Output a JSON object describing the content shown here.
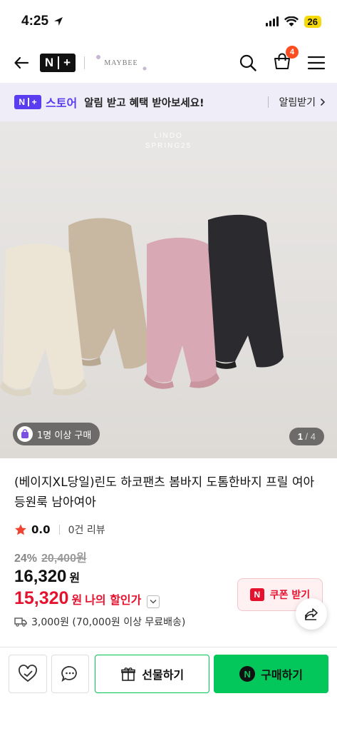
{
  "status_bar": {
    "time": "4:25",
    "battery": "26"
  },
  "header": {
    "store_badge": "N",
    "store_badge_plus": "+",
    "brand": "MAYBEE",
    "cart_count": "4"
  },
  "banner": {
    "store_badge": "N",
    "store_badge_plus": "+",
    "store_name": "스토어",
    "message": "알림 받고 혜택 받아보세요!",
    "action_label": "알림받기"
  },
  "hero": {
    "watermark_line1": "LINDO",
    "watermark_line2": "SPRING25",
    "buyer_label": "1명 이상 구매",
    "page_current": "1",
    "page_total": "4",
    "colors": {
      "cream": "#ece5d6",
      "beige": "#c8b8a2",
      "pink": "#d8a9b4",
      "black": "#2b2a2e",
      "background": "#e6e4e1"
    }
  },
  "product": {
    "title": "(베이지XL당일)린도 하코팬츠 봄바지 도톰한바지 프릴 여아 등원룩 남아여아",
    "rating": "0.0",
    "reviews": "0건 리뷰",
    "discount_pct": "24%",
    "original_price": "20,400원",
    "price": "16,320",
    "price_unit": "원",
    "my_price": "15,320",
    "my_price_unit": "원",
    "my_label": "나의 할인가",
    "coupon_label": "쿠폰 받기",
    "coupon_badge": "N",
    "shipping": "3,000원 (70,000원 이상 무료배송)"
  },
  "bottom_bar": {
    "gift_label": "선물하기",
    "buy_label": "구매하기",
    "buy_badge": "N"
  },
  "colors": {
    "accent_green": "#03c75a",
    "sale_red": "#e5122f",
    "store_purple": "#5a3df0"
  }
}
